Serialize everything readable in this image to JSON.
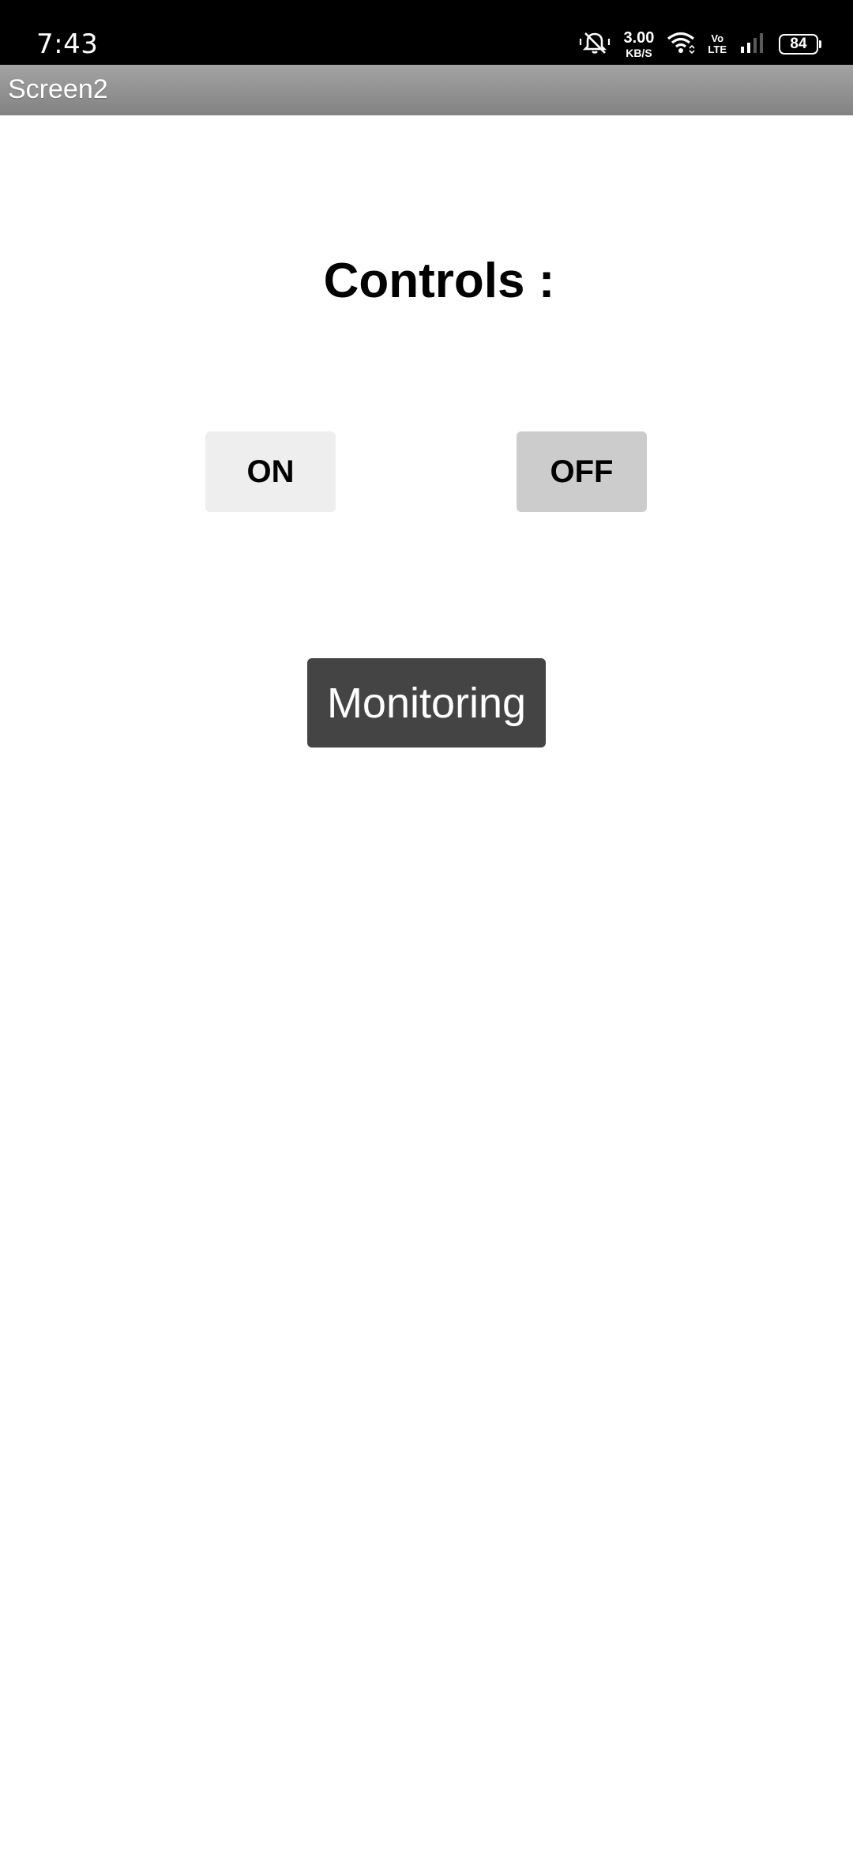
{
  "status_bar": {
    "time": "7:43",
    "speed_value": "3.00",
    "speed_unit": "KB/S",
    "volte_top": "Vo",
    "volte_bottom": "LTE",
    "battery_level": "84"
  },
  "title_bar": {
    "title": "Screen2"
  },
  "main": {
    "heading": "Controls :",
    "on_label": "ON",
    "off_label": "OFF",
    "monitoring_label": "Monitoring"
  },
  "icons": {
    "silent": "bell-off-icon",
    "wifi": "wifi-icon",
    "signal": "cell-signal-icon",
    "battery": "battery-icon"
  },
  "colors": {
    "status_bar_bg": "#000000",
    "title_bar_bg": "#8f8f8f",
    "on_button_bg": "#eeeeee",
    "off_button_bg": "#cccccc",
    "monitoring_button_bg": "#444444"
  }
}
